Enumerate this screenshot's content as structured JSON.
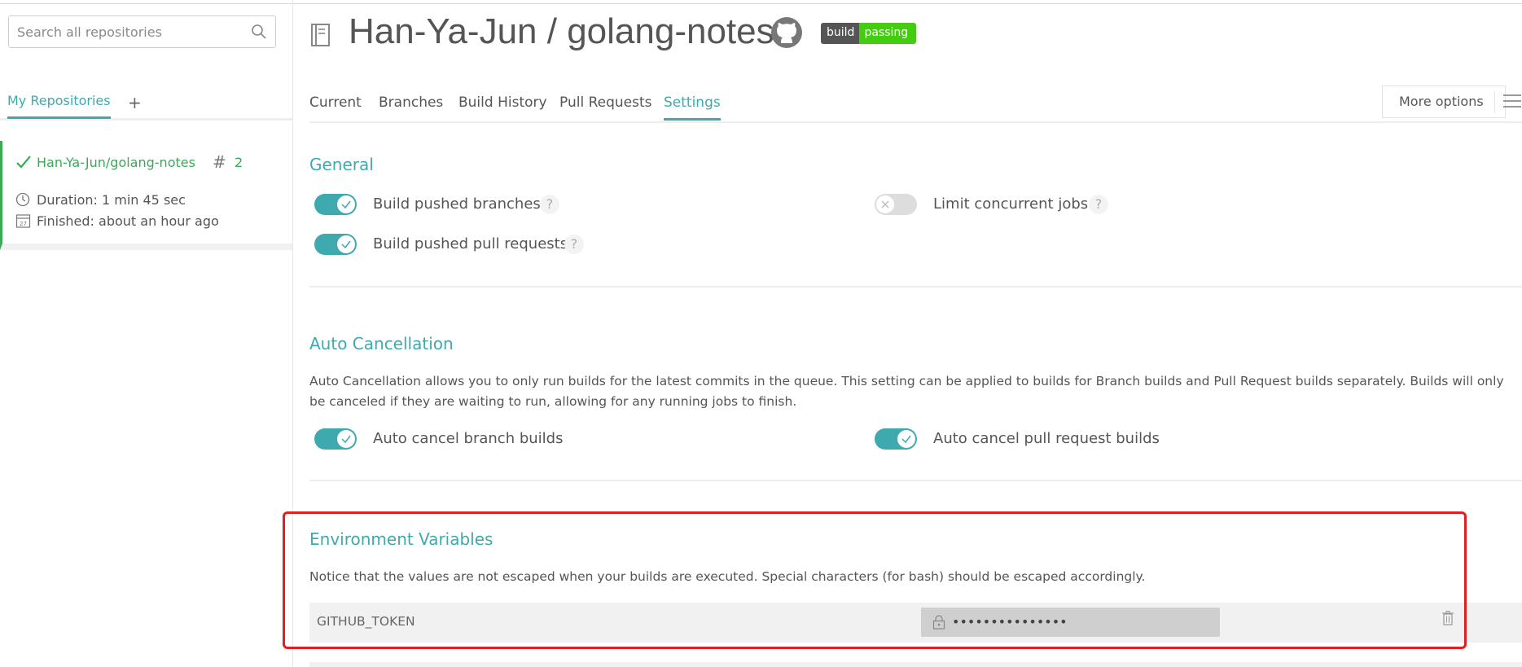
{
  "sidebar": {
    "search_placeholder": "Search all repositories",
    "tab_label": "My Repositories",
    "add_label": "+",
    "repo": {
      "name": "Han-Ya-Jun/golang-notes",
      "hash_symbol": "#",
      "build_number": "2",
      "duration": "Duration: 1 min 45 sec",
      "finished": "Finished: about an hour ago",
      "status_color": "#39aa56"
    }
  },
  "header": {
    "title": "Han-Ya-Jun / golang-notes",
    "badge_left": "build",
    "badge_right": "passing"
  },
  "tabs": [
    "Current",
    "Branches",
    "Build History",
    "Pull Requests",
    "Settings"
  ],
  "active_tab": "Settings",
  "more_options_label": "More options",
  "general": {
    "title": "General",
    "build_pushed_branches": "Build pushed branches",
    "build_pushed_prs": "Build pushed pull requests",
    "limit_concurrent_jobs": "Limit concurrent jobs",
    "help": "?",
    "toggles": {
      "build_pushed_branches": true,
      "build_pushed_prs": true,
      "limit_concurrent_jobs": false
    }
  },
  "auto_cancellation": {
    "title": "Auto Cancellation",
    "description": "Auto Cancellation allows you to only run builds for the latest commits in the queue. This setting can be applied to builds for Branch builds and Pull Request builds separately. Builds will only be canceled if they are waiting to run, allowing for any running jobs to finish.",
    "branch_label": "Auto cancel branch builds",
    "pr_label": "Auto cancel pull request builds",
    "toggles": {
      "branch": true,
      "pr": true
    }
  },
  "env_vars": {
    "title": "Environment Variables",
    "notice": "Notice that the values are not escaped when your builds are executed. Special characters (for bash) should be escaped accordingly.",
    "items": [
      {
        "name": "GITHUB_TOKEN",
        "value": "•••••••••••••••"
      }
    ]
  },
  "colors": {
    "accent": "#3eaaaf",
    "passing": "#39aa56",
    "highlight": "#e02020"
  }
}
